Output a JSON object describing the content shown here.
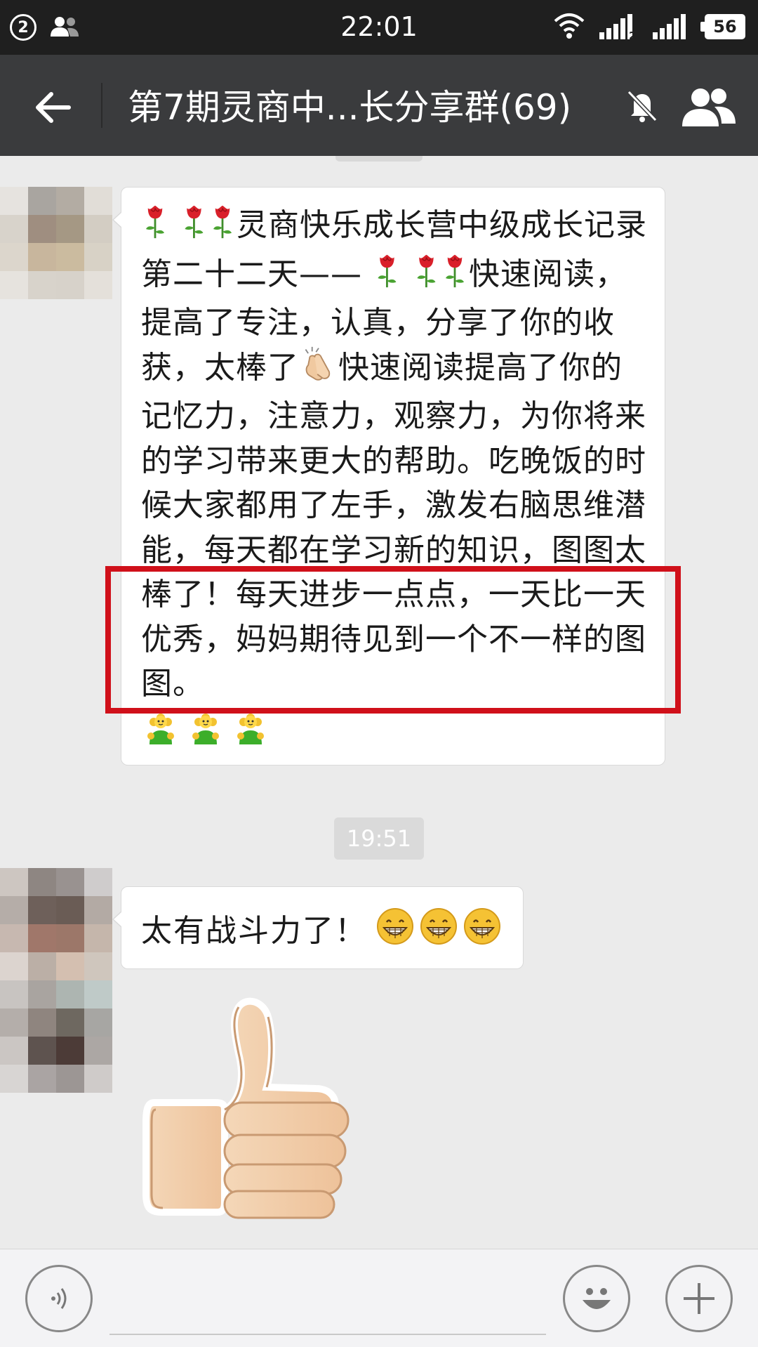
{
  "status_bar": {
    "notification_count": "2",
    "time": "22:01",
    "sim2_label": "2",
    "battery": "56"
  },
  "header": {
    "title": "第7期灵商中...长分享群(69)",
    "back_icon": "back-arrow-icon",
    "mute_icon": "bell-muted-icon",
    "members_icon": "group-members-icon"
  },
  "messages": [
    {
      "sender_avatar": "pixelated-avatar",
      "text_parts": [
        "灵商快乐成长营中级成长记录第二十二天——",
        "快速阅读，提高了专注，认真，分享了你的收获，太棒了",
        "快速阅读提高了你的记忆力，注意力，观察力，为你将来的学习带来更大的帮助。吃晚饭的时候大家都用了左手，激发右脑思维潜能，每天都在学习新的知识，图图太棒了！每天进步一点点，一天比一天优秀，妈妈期待见到一个不一样的图图。"
      ],
      "emoji": [
        "rose",
        "rose",
        "rose",
        "rose",
        "rose",
        "rose",
        "clapping-hands",
        "flower-face",
        "flower-face",
        "flower-face"
      ]
    },
    {
      "sender_avatar": "pixelated-avatar",
      "text": "太有战斗力了！",
      "emoji": [
        "grinning-face",
        "grinning-face",
        "grinning-face"
      ]
    },
    {
      "sticker": "thumbs-up-sticker"
    }
  ],
  "timestamp": "19:51",
  "input_bar": {
    "voice_icon": "voice-icon",
    "emoji_icon": "smiley-icon",
    "more_icon": "plus-icon"
  },
  "colors": {
    "status_bar": "#1f1f1f",
    "title_bar": "#3a3b3d",
    "chat_background": "#ebebeb",
    "highlight": "#d0101a"
  }
}
